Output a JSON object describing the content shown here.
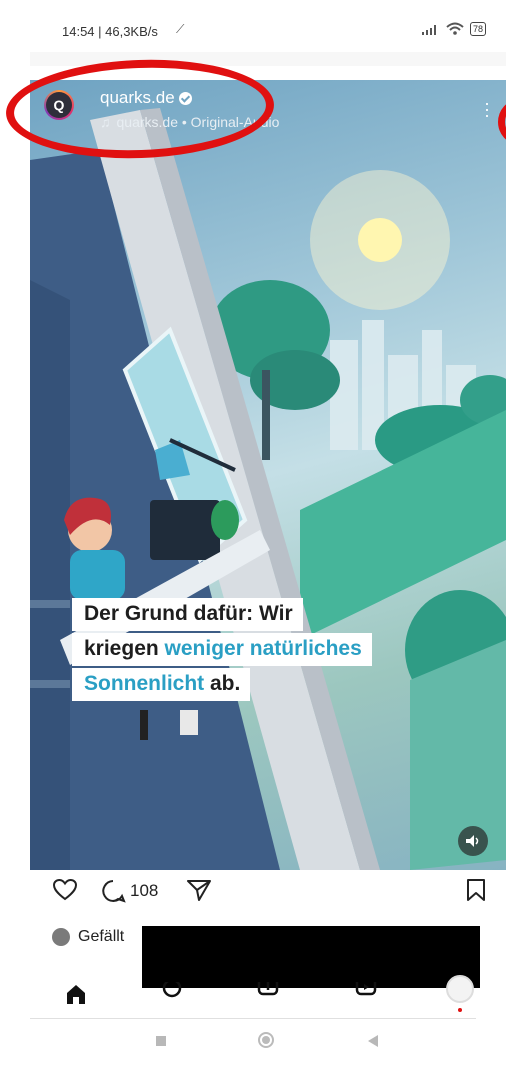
{
  "status_bar": {
    "time_speed": "14:54 | 46,3KB/s",
    "battery": "78"
  },
  "reel": {
    "username": "quarks.de",
    "audio_label": "quarks.de • Original-Audio",
    "avatar_letter": "Q",
    "caption_lines": [
      [
        {
          "text": "Der Grund dafür: Wir",
          "accent": false
        }
      ],
      [
        {
          "text": "kriegen ",
          "accent": false
        },
        {
          "text": "weniger natürliches",
          "accent": true
        }
      ],
      [
        {
          "text": "Sonnenlicht",
          "accent": true
        },
        {
          "text": " ab.",
          "accent": false
        }
      ]
    ],
    "caption_accent_color": "#2a9fc4",
    "annotation_color": "#e01010"
  },
  "actions": {
    "comment_count": "108"
  },
  "likes": {
    "text": "Gefällt"
  },
  "bottom_nav": {
    "items": [
      "home-icon",
      "search-icon",
      "create-icon",
      "reels-icon",
      "profile-avatar"
    ]
  },
  "icons": {
    "like": "heart-icon",
    "comment": "comment-icon",
    "share": "send-icon",
    "save": "bookmark-icon",
    "volume": "volume-icon"
  }
}
